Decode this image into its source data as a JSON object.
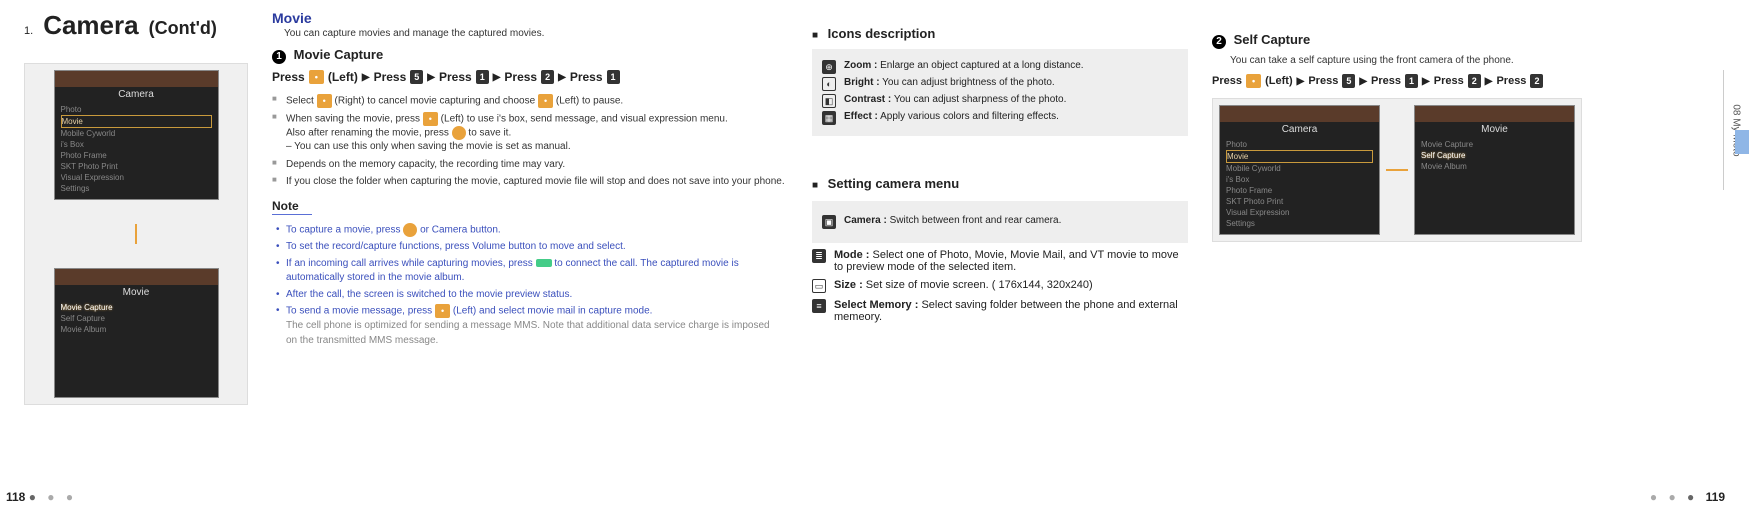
{
  "header": {
    "num": "1.",
    "title": "Camera",
    "cont": "(Cont'd)"
  },
  "side_tab": {
    "label": "08  My Moto"
  },
  "page_left": "118",
  "page_right": "119",
  "phone1": {
    "title": "Camera",
    "items": [
      "Photo",
      "Movie",
      "Mobile Cyworld",
      "i's Box",
      "Photo Frame",
      "SKT Photo Print",
      "Visual Expression",
      "Settings"
    ],
    "hl_index": 1
  },
  "phone2": {
    "title": "Movie",
    "items": [
      "Movie Capture",
      "Self Capture",
      "Movie Album"
    ],
    "hl_index": 0
  },
  "phone_right_a": {
    "title": "Camera",
    "items": [
      "Photo",
      "Movie",
      "Mobile Cyworld",
      "i's Box",
      "Photo Frame",
      "SKT Photo Print",
      "Visual Expression",
      "Settings"
    ],
    "hl_index": 1
  },
  "phone_right_b": {
    "title": "Movie",
    "items": [
      "Movie Capture",
      "Self Capture",
      "Movie Album"
    ],
    "hl_index": 1
  },
  "movie": {
    "head": "Movie",
    "desc": "You can capture movies and manage the captured movies.",
    "cap_num": "1",
    "cap_head": "Movie Capture",
    "seq": {
      "press": "Press",
      "left": "(Left)",
      "k5": "5",
      "k1": "1",
      "k2": "2",
      "k1b": "1"
    },
    "bul1a": "Select ",
    "bul1b": " (Right) to cancel movie capturing and choose ",
    "bul1c": " (Left) to pause.",
    "bul2a": "When saving the movie, press ",
    "bul2b": " (Left) to use i's box, send message, and visual expression menu.",
    "bul2c": "Also after renaming the movie, press ",
    "bul2d": " to save it.",
    "bul2e": "– You can use this only when saving the movie is set as manual.",
    "bul3": "Depends on the memory capacity, the recording time may vary.",
    "bul4": "If you close the folder when capturing the movie, captured movie file will stop and does not save into your phone.",
    "note_head": "Note",
    "n1a": "To capture a movie, press ",
    "n1b": " or Camera button.",
    "n2": "To set the record/capture functions, press Volume button to move and select.",
    "n3a": "If an incoming call arrives while capturing movies, press ",
    "n3b": " to connect the call. The captured movie is automatically stored in the movie album.",
    "n4": "After the call, the screen is switched to the movie preview status.",
    "n5a": "To send a movie message, press ",
    "n5b": " (Left) and select movie mail in capture mode.",
    "n5c": "The cell phone is optimized for sending a message MMS. Note that additional data service charge is imposed on the transmitted MMS message."
  },
  "icons": {
    "head": "Icons description",
    "zoom_l": "Zoom :",
    "zoom_t": "Enlarge an object captured at a long distance.",
    "bright_l": "Bright :",
    "bright_t": "You can adjust brightness of the photo.",
    "contrast_l": "Contrast :",
    "contrast_t": "You can adjust sharpness of the photo.",
    "effect_l": "Effect :",
    "effect_t": "Apply various colors and filtering effects."
  },
  "setting": {
    "head": "Setting camera menu",
    "cam_l": "Camera :",
    "cam_t": "Switch between front and rear camera.",
    "mode_l": "Mode :",
    "mode_t": "Select one of Photo, Movie, Movie Mail, and VT movie to move to preview mode of the selected item.",
    "size_l": "Size :",
    "size_t": "Set size of movie screen. ( 176x144, 320x240)",
    "mem_l": "Select Memory :",
    "mem_t": "Select saving folder between the phone and external memeory."
  },
  "self": {
    "num": "2",
    "head": "Self Capture",
    "desc": "You can take a self capture using the front camera of the phone.",
    "seq": {
      "press": "Press",
      "left": "(Left)",
      "k5": "5",
      "k1": "1",
      "k2": "2",
      "k2b": "2"
    }
  }
}
